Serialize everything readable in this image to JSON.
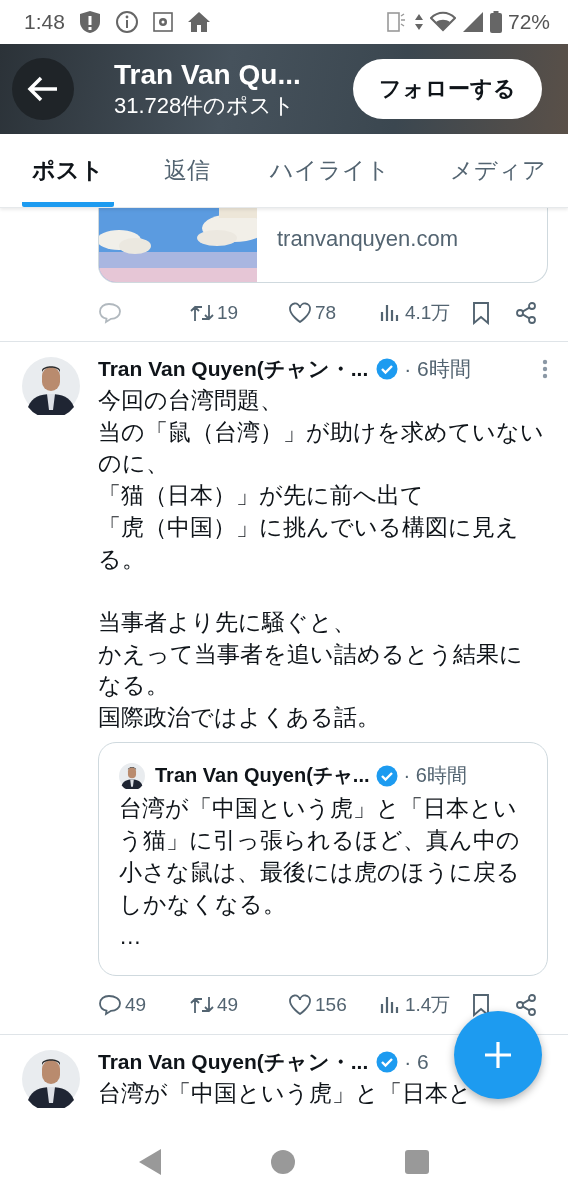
{
  "status_bar": {
    "time": "1:48",
    "battery": "72%"
  },
  "header": {
    "name": "Tran Van Qu...",
    "post_count": "31.728件のポスト",
    "follow_button": "フォローする"
  },
  "tabs": [
    {
      "label": "ポスト",
      "selected": true
    },
    {
      "label": "返信",
      "selected": false
    },
    {
      "label": "ハイライト",
      "selected": false
    },
    {
      "label": "メディア",
      "selected": false
    }
  ],
  "posts": [
    {
      "kind": "link_tail",
      "link_card": {
        "domain": "tranvanquyen.com"
      },
      "actions": {
        "reposts": "19",
        "likes": "78",
        "views": "4.1万"
      }
    },
    {
      "kind": "post",
      "author": "Tran Van Quyen(チャン・...",
      "time": "· 6時間",
      "paragraphs": [
        [
          "今回の台湾問題、",
          "当の「鼠（台湾）」が助けを求めていないのに、",
          "「猫（日本）」が先に前へ出て",
          "「虎（中国）」に挑んでいる構図に見える。"
        ],
        [
          "当事者より先に騒ぐと、",
          "かえって当事者を追い詰めるとう結果になる。",
          "国際政治ではよくある話。"
        ]
      ],
      "quote": {
        "author": "Tran Van Quyen(チャ...",
        "time": "· 6時間",
        "lines": [
          "台湾が「中国という虎」と「日本という猫」に引っ張られるほど、真ん中の小さな鼠は、最後には虎のほうに戻るしかなくなる。",
          "…"
        ]
      },
      "actions": {
        "replies": "49",
        "reposts": "49",
        "likes": "156",
        "views": "1.4万"
      }
    },
    {
      "kind": "post",
      "author": "Tran Van Quyen(チャン・...",
      "time": "· 6",
      "paragraphs": [
        [
          "台湾が「中国という虎」と「日本と"
        ]
      ]
    }
  ]
}
